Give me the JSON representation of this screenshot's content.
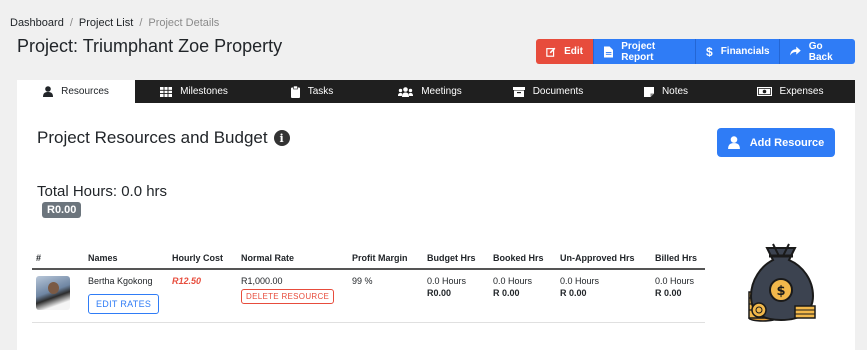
{
  "breadcrumb": {
    "dashboard": "Dashboard",
    "project_list": "Project List",
    "current": "Project Details",
    "sep": "/"
  },
  "page_title": "Project: Triumphant Zoe Property",
  "actions": {
    "edit": "Edit",
    "project_report": "Project Report",
    "financials": "Financials",
    "go_back": "Go Back"
  },
  "tabs": [
    {
      "label": "Resources",
      "icon": "user-icon"
    },
    {
      "label": "Milestones",
      "icon": "table-icon"
    },
    {
      "label": "Tasks",
      "icon": "clipboard-icon"
    },
    {
      "label": "Meetings",
      "icon": "users-icon"
    },
    {
      "label": "Documents",
      "icon": "archive-icon"
    },
    {
      "label": "Notes",
      "icon": "note-icon"
    },
    {
      "label": "Expenses",
      "icon": "money-bill-icon"
    }
  ],
  "section": {
    "title": "Project Resources and Budget",
    "info": "i",
    "add_resource": "Add Resource"
  },
  "summary": {
    "total_hours": "Total Hours: 0.0 hrs",
    "amount": "R0.00"
  },
  "table": {
    "headers": [
      "#",
      "Names",
      "Hourly Cost",
      "Normal Rate",
      "Profit Margin",
      "Budget Hrs",
      "Booked Hrs",
      "Un-Approved Hrs",
      "Billed Hrs"
    ],
    "rows": [
      {
        "name": "Bertha Kgokong",
        "edit_rates": "EDIT RATES",
        "hourly_cost": "R12.50",
        "normal_rate": "R1,000.00",
        "delete_resource": "DELETE RESOURCE",
        "profit_margin": "99 %",
        "budget_hrs": "0.0 Hours",
        "budget_amt": "R0.00",
        "booked_hrs": "0.0 Hours",
        "booked_amt": "R 0.00",
        "unapproved_hrs": "0.0 Hours",
        "unapproved_amt": "R 0.00",
        "billed_hrs": "0.0 Hours",
        "billed_amt": "R 0.00"
      }
    ]
  },
  "colors": {
    "danger": "#e74c3c",
    "primary": "#2f7cf6",
    "dark_tabs": "#1f1f1f",
    "badge": "#6c757d"
  }
}
